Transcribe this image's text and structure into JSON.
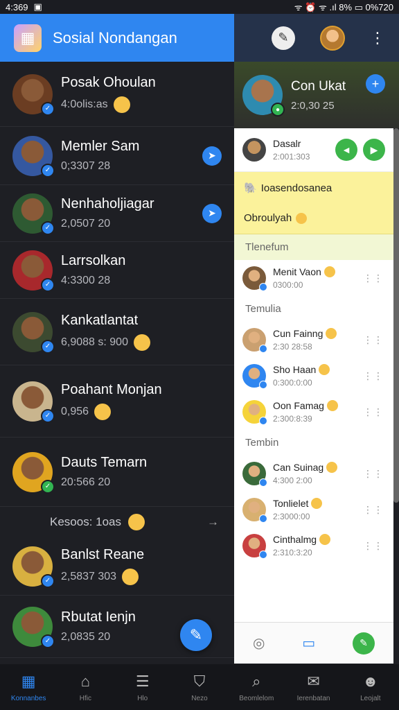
{
  "status": {
    "time": "4:369",
    "right": "ᯤ ⏰ ᯤ .ıl 8% ▭ 0%720"
  },
  "header": {
    "title": "Sosial Nondangan"
  },
  "right_header": {
    "contact_name": "Con Ukat",
    "contact_sub": "2:0,30 25"
  },
  "chats": [
    {
      "name": "Posak Ohoulan",
      "sub": "4:0olis:as",
      "emoji": true,
      "badge": "blue",
      "color": "#6b3d22"
    },
    {
      "name": "Memler Sam",
      "sub": "0;3307 28",
      "send": true,
      "badge": "blue",
      "color": "#3558a0"
    },
    {
      "name": "Nenhaholjiagar",
      "sub": "2,0507 20",
      "send": true,
      "badge": "blue",
      "color": "#2e5a32"
    },
    {
      "name": "Larrsolkan",
      "sub": "4:3300 28",
      "badge": "blue",
      "color": "#a8282c"
    },
    {
      "name": "Kankatlantat",
      "sub": "6,9088 s: 900",
      "emoji": true,
      "badge": "blue",
      "color": "#3c4a30"
    },
    {
      "name": "Poahant Monjan",
      "sub": "0,956",
      "emoji": true,
      "badge": "blue",
      "color": "#c9b58e"
    },
    {
      "name": "Dauts Temarn",
      "sub": "20:566 20",
      "badge": "green",
      "color": "#e0a520"
    },
    {
      "name": "Banlst Reane",
      "sub": "2,5837 303",
      "emoji": true,
      "badge": "blue",
      "color": "#d8b040"
    },
    {
      "name": "Rbutat Ienjn",
      "sub": "2,0835 20",
      "badge": "blue",
      "color": "#3e8a3c"
    }
  ],
  "chat_divider": {
    "label": "Kesoos: 1oas"
  },
  "panel": {
    "top_row": {
      "name": "Dasalr",
      "sub": "2:001:303"
    },
    "yellow": {
      "label": "Ioasendosanea",
      "note": "Obroulyah"
    },
    "sections": [
      {
        "title": "Tlenefum",
        "items": [
          {
            "name": "Menit Vaon",
            "sub": "0300:00"
          }
        ]
      },
      {
        "title": "Temulia",
        "items": [
          {
            "name": "Cun Fainng",
            "sub": "2:30 28:58"
          },
          {
            "name": "Sho Haan",
            "sub": "0:300:0:00"
          },
          {
            "name": "Oon Famag",
            "sub": "2:300:8:39"
          }
        ]
      },
      {
        "title": "Tembin",
        "items": [
          {
            "name": "Can Suinag",
            "sub": "4:300 2:00"
          },
          {
            "name": "Tonlielet",
            "sub": "2:3000:00"
          },
          {
            "name": "Cinthalmg",
            "sub": "2:310:3:20"
          }
        ]
      }
    ]
  },
  "nav": [
    {
      "label": "Konnanbes",
      "icon": "grid-icon",
      "active": true
    },
    {
      "label": "Hfic",
      "icon": "home-icon"
    },
    {
      "label": "Hlo",
      "icon": "menu-icon"
    },
    {
      "label": "Nezo",
      "icon": "shield-icon"
    },
    {
      "label": "Beomlelom",
      "icon": "search-icon"
    },
    {
      "label": "Ierenbatan",
      "icon": "inbox-icon"
    },
    {
      "label": "Leojalt",
      "icon": "user-icon"
    }
  ]
}
